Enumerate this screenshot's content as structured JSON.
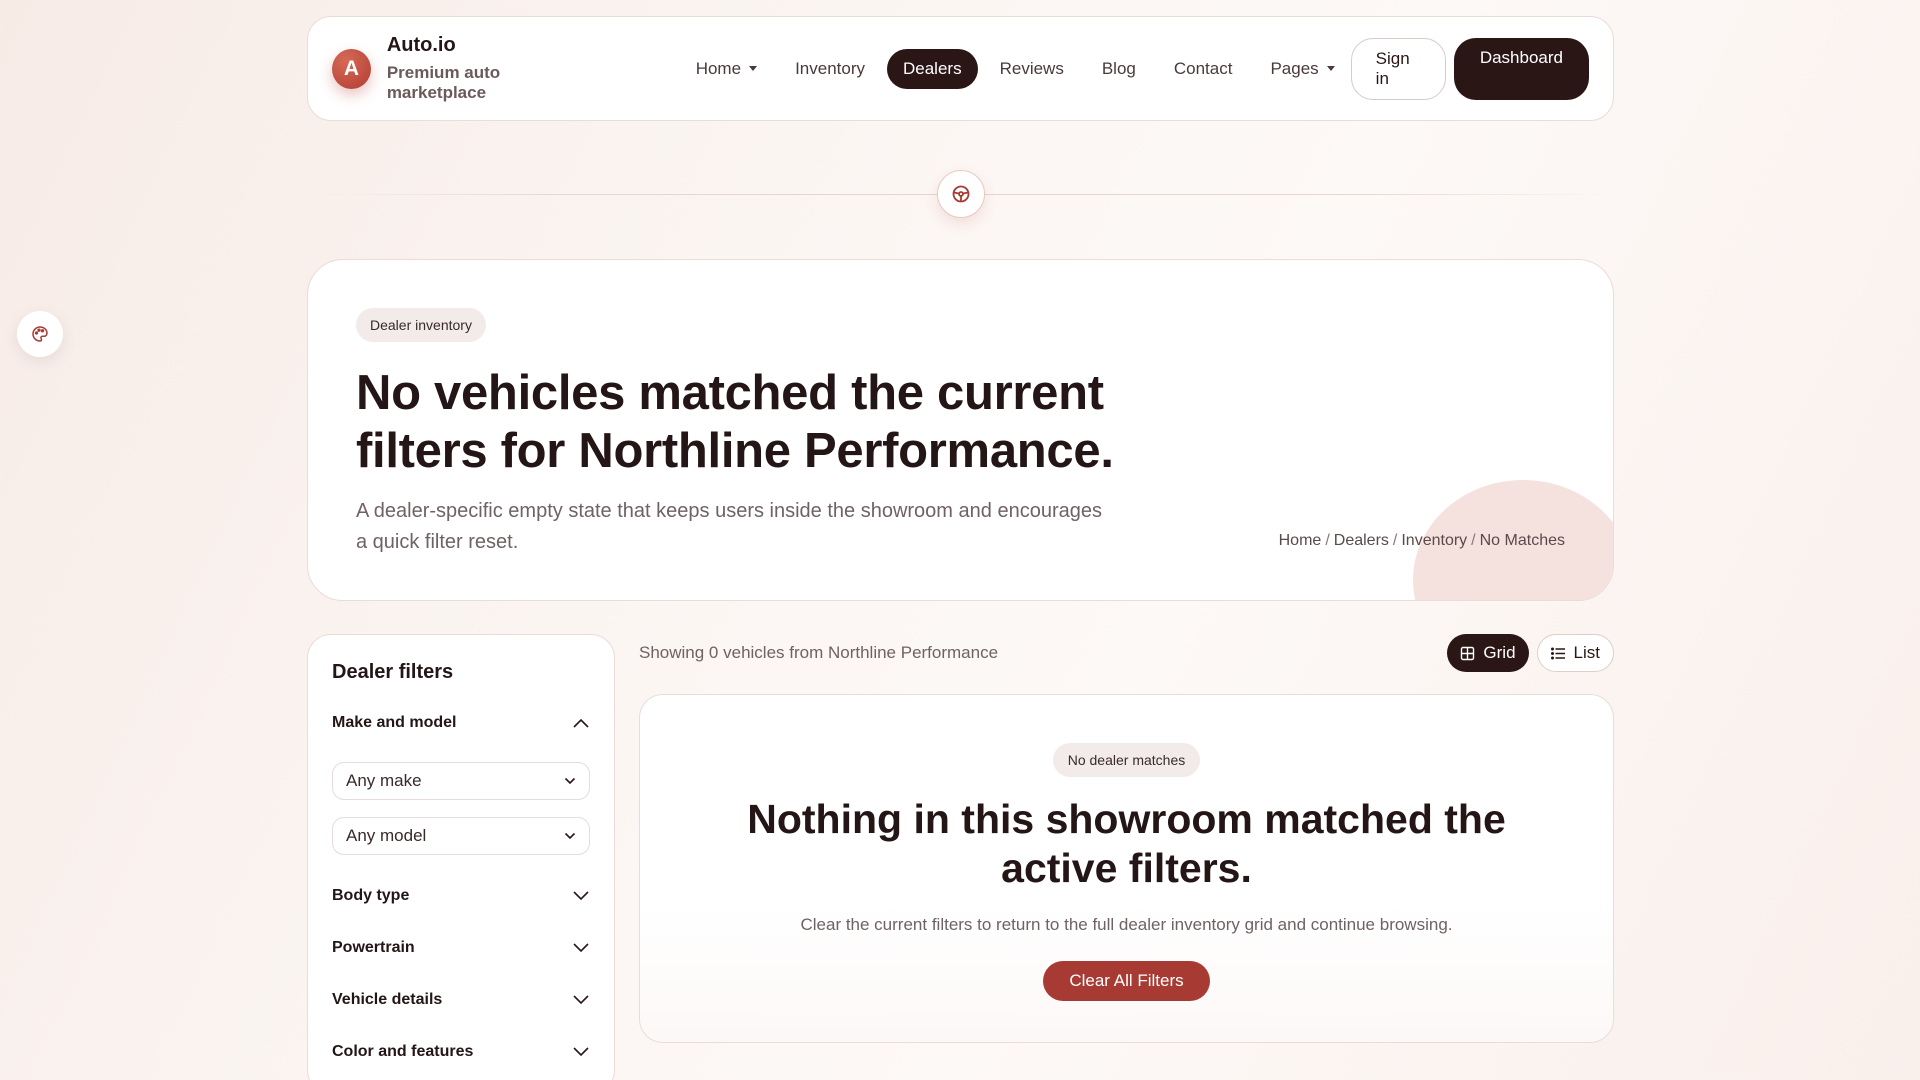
{
  "brand": {
    "logo_letter": "A",
    "name": "Auto.io",
    "tagline": "Premium auto marketplace"
  },
  "nav": {
    "items": [
      {
        "label": "Home",
        "dropdown": true,
        "active": false
      },
      {
        "label": "Inventory",
        "dropdown": false,
        "active": false
      },
      {
        "label": "Dealers",
        "dropdown": false,
        "active": true
      },
      {
        "label": "Reviews",
        "dropdown": false,
        "active": false
      },
      {
        "label": "Blog",
        "dropdown": false,
        "active": false
      },
      {
        "label": "Contact",
        "dropdown": false,
        "active": false
      },
      {
        "label": "Pages",
        "dropdown": true,
        "active": false
      }
    ],
    "sign_in": "Sign in",
    "dashboard": "Dashboard"
  },
  "hero": {
    "pill": "Dealer inventory",
    "title": "No vehicles matched the current filters for Northline Performance.",
    "subtitle": "A dealer-specific empty state that keeps users inside the showroom and encourages a quick filter reset.",
    "breadcrumb": [
      "Home",
      "Dealers",
      "Inventory",
      "No Matches"
    ]
  },
  "sidebar": {
    "title": "Dealer filters",
    "make_model": {
      "label": "Make and model",
      "make_value": "Any make",
      "model_value": "Any model"
    },
    "sections": [
      "Body type",
      "Powertrain",
      "Vehicle details",
      "Color and features"
    ]
  },
  "results": {
    "showing": "Showing 0 vehicles from Northline Performance",
    "grid_label": "Grid",
    "list_label": "List",
    "empty": {
      "pill": "No dealer matches",
      "title": "Nothing in this showroom matched the active filters.",
      "subtitle": "Clear the current filters to return to the full dealer inventory grid and continue browsing.",
      "button": "Clear All Filters"
    }
  },
  "colors": {
    "accent": "#a73a33",
    "dark": "#2b1616",
    "logo": "#c0493b"
  }
}
